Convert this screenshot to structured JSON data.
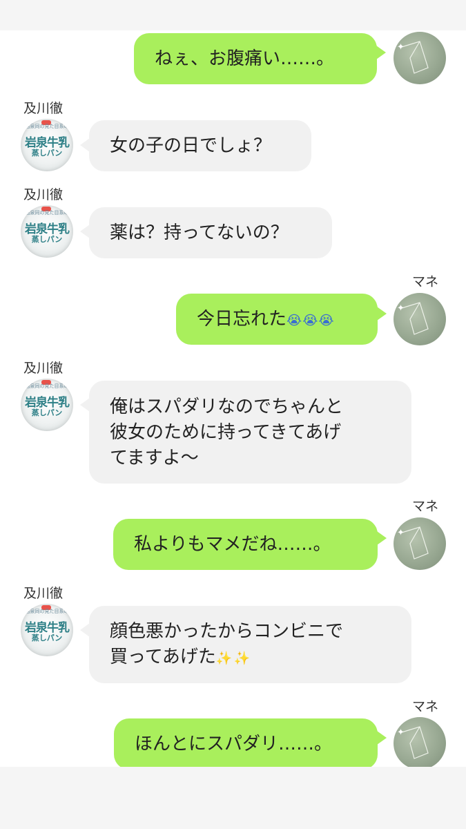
{
  "conversation": {
    "other_name": "及川徹",
    "self_name": "マネ",
    "avatar_other": {
      "top_text": "岩泉同の見た目系の",
      "main_text": "岩泉牛乳",
      "sub_text": "蒸しパン",
      "colors": {
        "text": "#2d7f86"
      }
    },
    "avatar_self": {
      "icon": "constellation-icon",
      "colors": {
        "bg": "#98a892",
        "star": "#ffffff"
      }
    },
    "colors": {
      "self_bubble": "#a9ef5c",
      "other_bubble": "#f1f1f1"
    },
    "messages": [
      {
        "sender": "self",
        "lines": [
          "ねぇ、お腹痛い……。"
        ]
      },
      {
        "sender": "other",
        "name": "及川徹",
        "lines": [
          "女の子の日でしょ？"
        ]
      },
      {
        "sender": "other",
        "name": "及川徹",
        "lines": [
          "薬は？持ってないの？"
        ]
      },
      {
        "sender": "self",
        "name": "マネ",
        "lines": [
          "今日忘れた"
        ],
        "emoji": "😭😭😭",
        "emoji_icon": "crying-face-icon"
      },
      {
        "sender": "other",
        "name": "及川徹",
        "lines": [
          "俺はスパダリなのでちゃんと",
          "彼女のために持ってきてあげ",
          "てますよ〜"
        ]
      },
      {
        "sender": "self",
        "name": "マネ",
        "lines": [
          "私よりもマメだね……。"
        ]
      },
      {
        "sender": "other",
        "name": "及川徹",
        "lines": [
          "顔色悪かったからコンビニで",
          "買ってあげた"
        ],
        "emoji": "✨✨",
        "emoji_icon": "sparkles-icon"
      },
      {
        "sender": "self",
        "name": "マネ",
        "lines": [
          "ほんとにスパダリ……。"
        ]
      }
    ]
  }
}
